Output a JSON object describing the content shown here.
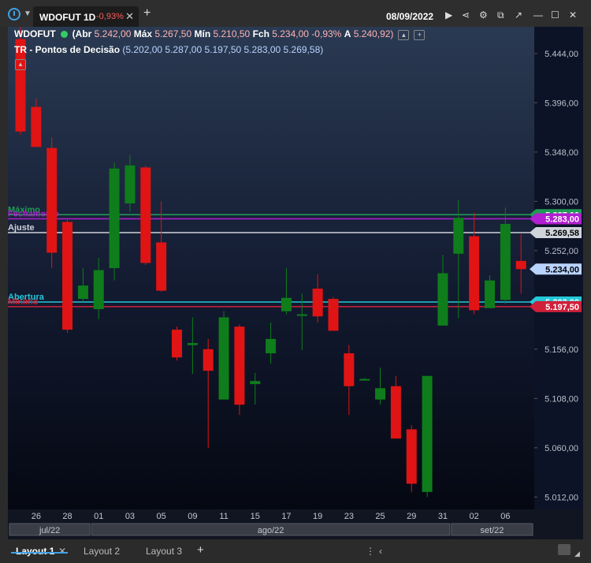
{
  "app": {
    "tab_title": "WDOFUT 1D",
    "tab_change": "-0,93%",
    "date": "08/09/2022",
    "icons": [
      "clock-icon",
      "chevron-down-icon",
      "close-icon",
      "add-tab-icon",
      "play-icon",
      "share-icon",
      "settings-icon",
      "chart-icon",
      "minimize-icon",
      "maximize-icon",
      "close-window-icon"
    ]
  },
  "header": {
    "symbol": "WDOFUT",
    "open_label": "(Abr",
    "open": "5.242,00",
    "high_label": "Máx",
    "high": "5.267,50",
    "low_label": "Mín",
    "low": "5.210,50",
    "close_label": "Fch",
    "close": "5.234,00",
    "change": "-0,93%",
    "avg_label": "A",
    "avg": "5.240,92)"
  },
  "indicator": {
    "name": "TR - Pontos de Decisão",
    "values": "(5.202,00  5.287,00  5.197,50  5.283,00  5.269,58)"
  },
  "chart_data": {
    "type": "candlestick",
    "y_ticks": [
      5012,
      5060,
      5108,
      5156,
      5204,
      5252,
      5300,
      5348,
      5396,
      5444
    ],
    "y_tick_labels": [
      "5.012,00",
      "5.060,00",
      "5.108,00",
      "5.156,00",
      "5.204,00",
      "5.252,00",
      "5.300,00",
      "5.348,00",
      "5.396,00",
      "5.444,00"
    ],
    "ylim": [
      5000,
      5470
    ],
    "x_tick_labels": [
      "26",
      "28",
      "01",
      "03",
      "05",
      "09",
      "11",
      "15",
      "17",
      "19",
      "23",
      "25",
      "29",
      "31",
      "02",
      "06"
    ],
    "x_tick_index": [
      1,
      3,
      5,
      7,
      9,
      11,
      13,
      15,
      17,
      19,
      21,
      23,
      25,
      27,
      29,
      31
    ],
    "months": [
      {
        "label": "jul/22",
        "from": 0,
        "to": 4
      },
      {
        "label": "ago/22",
        "from": 5,
        "to": 27
      },
      {
        "label": "set/22",
        "from": 28,
        "to": 32
      }
    ],
    "candles": [
      {
        "o": 5458,
        "h": 5470,
        "l": 5365,
        "c": 5368
      },
      {
        "o": 5392,
        "h": 5400,
        "l": 5353,
        "c": 5353
      },
      {
        "o": 5352,
        "h": 5362,
        "l": 5235,
        "c": 5250
      },
      {
        "o": 5280,
        "h": 5282,
        "l": 5172,
        "c": 5175
      },
      {
        "o": 5205,
        "h": 5235,
        "l": 5202,
        "c": 5218
      },
      {
        "o": 5195,
        "h": 5245,
        "l": 5185,
        "c": 5233
      },
      {
        "o": 5235,
        "h": 5338,
        "l": 5223,
        "c": 5332
      },
      {
        "o": 5298,
        "h": 5345,
        "l": 5290,
        "c": 5335
      },
      {
        "o": 5333,
        "h": 5335,
        "l": 5238,
        "c": 5240
      },
      {
        "o": 5260,
        "h": 5300,
        "l": 5212,
        "c": 5213
      },
      {
        "o": 5175,
        "h": 5178,
        "l": 5145,
        "c": 5148
      },
      {
        "o": 5160,
        "h": 5187,
        "l": 5132,
        "c": 5162
      },
      {
        "o": 5156,
        "h": 5166,
        "l": 5060,
        "c": 5135
      },
      {
        "o": 5107,
        "h": 5193,
        "l": 5107,
        "c": 5187
      },
      {
        "o": 5178,
        "h": 5180,
        "l": 5092,
        "c": 5102
      },
      {
        "o": 5122,
        "h": 5133,
        "l": 5102,
        "c": 5125
      },
      {
        "o": 5152,
        "h": 5182,
        "l": 5142,
        "c": 5166
      },
      {
        "o": 5193,
        "h": 5235,
        "l": 5190,
        "c": 5206
      },
      {
        "o": 5190,
        "h": 5210,
        "l": 5155,
        "c": 5190
      },
      {
        "o": 5215,
        "h": 5229,
        "l": 5182,
        "c": 5188
      },
      {
        "o": 5205,
        "h": 5207,
        "l": 5174,
        "c": 5174
      },
      {
        "o": 5152,
        "h": 5160,
        "l": 5092,
        "c": 5120
      },
      {
        "o": 5127,
        "h": 5128,
        "l": 5127,
        "c": 5127
      },
      {
        "o": 5107,
        "h": 5138,
        "l": 5102,
        "c": 5118
      },
      {
        "o": 5120,
        "h": 5130,
        "l": 5072,
        "c": 5069
      },
      {
        "o": 5078,
        "h": 5082,
        "l": 5017,
        "c": 5025
      },
      {
        "o": 5017,
        "h": 5130,
        "l": 5012,
        "c": 5130
      },
      {
        "o": 5179,
        "h": 5248,
        "l": 5179,
        "c": 5230
      },
      {
        "o": 5249,
        "h": 5301,
        "l": 5186,
        "c": 5284
      },
      {
        "o": 5266,
        "h": 5289,
        "l": 5190,
        "c": 5194
      },
      {
        "o": 5196,
        "h": 5228,
        "l": 5198,
        "c": 5223
      },
      {
        "o": 5204,
        "h": 5294,
        "l": 5200,
        "c": 5278
      },
      {
        "o": 5242,
        "h": 5268,
        "l": 5210,
        "c": 5234
      }
    ],
    "lines": [
      {
        "name": "Máximo",
        "value": 5287.0,
        "color": "#1f9d55",
        "label": "5.287,00"
      },
      {
        "name": "Fechamento",
        "value": 5283.0,
        "color": "#b01fd0",
        "label": "5.283,00"
      },
      {
        "name": "Ajuste",
        "value": 5269.58,
        "color": "#cfd3da",
        "label": "5.269,58"
      },
      {
        "name": "Abertura",
        "value": 5202.0,
        "color": "#22c9d8",
        "label": "5.202,00"
      },
      {
        "name": "Mínimo",
        "value": 5197.5,
        "color": "#d0203a",
        "label": "5.197,50"
      }
    ],
    "last_price": {
      "value": 5234.0,
      "label": "5.234,00",
      "color": "#b9d3ff"
    },
    "up_color": "#0f7d1b",
    "down_color": "#e01414"
  },
  "layouts": [
    "Layout 1",
    "Layout 2",
    "Layout 3"
  ],
  "active_layout": "Layout 1"
}
